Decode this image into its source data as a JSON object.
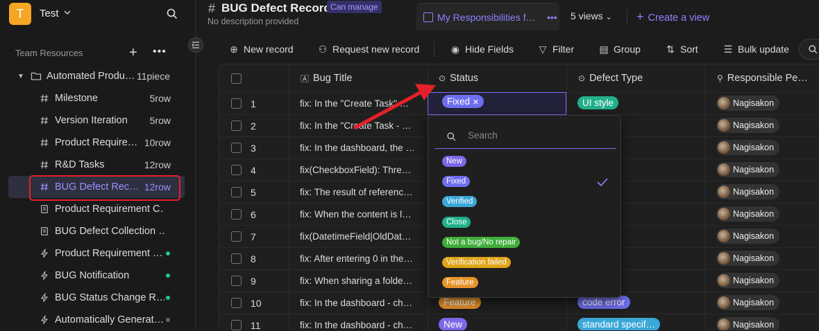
{
  "workspace": {
    "initial": "T",
    "name": "Test"
  },
  "sidebar": {
    "section_label": "Team Resources",
    "folder": {
      "label": "Automated Produ…",
      "count": "11piece"
    },
    "items": [
      {
        "label": "Milestone",
        "count": "5row",
        "icon": "hash-icon"
      },
      {
        "label": "Version Iteration",
        "count": "5row",
        "icon": "hash-icon"
      },
      {
        "label": "Product Require…",
        "count": "10row",
        "icon": "hash-icon"
      },
      {
        "label": "R&D Tasks",
        "count": "12row",
        "icon": "hash-icon"
      },
      {
        "label": "BUG Defect Rec…",
        "count": "12row",
        "icon": "hash-icon"
      },
      {
        "label": "Product Requirement C…",
        "count": "",
        "icon": "form-icon"
      },
      {
        "label": "BUG Defect Collection …",
        "count": "",
        "icon": "form-icon"
      },
      {
        "label": "Product Requirement …",
        "count": "",
        "icon": "automation-icon",
        "dot": "#22c58b"
      },
      {
        "label": "BUG Notification",
        "count": "",
        "icon": "automation-icon",
        "dot": "#22c58b"
      },
      {
        "label": "BUG Status Change R…",
        "count": "",
        "icon": "automation-icon",
        "dot": "#22c58b"
      },
      {
        "label": "Automatically Generat…",
        "count": "",
        "icon": "automation-icon",
        "dot": "#666666"
      }
    ]
  },
  "header": {
    "title": "BUG Defect Record",
    "badge": "Can manage",
    "description": "No description provided",
    "view_tab": "My Responsibilities f…",
    "views": "5 views",
    "create_view": "Create a view"
  },
  "toolbar": {
    "new_record": "New record",
    "request_new": "Request new record",
    "hide_fields": "Hide Fields",
    "filter": "Filter",
    "group": "Group",
    "sort": "Sort",
    "bulk_update": "Bulk update"
  },
  "columns": {
    "title": "Bug Title",
    "status": "Status",
    "defect_type": "Defect Type",
    "responsible": "Responsible Pe…"
  },
  "rows": [
    {
      "n": "1",
      "title": "fix: In the \"Create Task\" …",
      "status": "Fixed",
      "status_color": "#6e6ef0",
      "type": "UI style",
      "type_color": "#22b08c",
      "person": "Nagisakon"
    },
    {
      "n": "2",
      "title": "fix: In the \"Create Task - …",
      "status": "",
      "status_color": "",
      "type": "efect",
      "type_color": "#3fae3a",
      "person": "Nagisakon"
    },
    {
      "n": "3",
      "title": "fix: In the dashboard, the …",
      "status": "",
      "status_color": "",
      "type": "nce",
      "type_color": "#e8932a",
      "person": "Nagisakon"
    },
    {
      "n": "4",
      "title": "fix(CheckboxField): Thre…",
      "status": "",
      "status_color": "",
      "type": "or",
      "type_color": "#6e6ef0",
      "person": "Nagisakon"
    },
    {
      "n": "5",
      "title": "fix: The result of referenc…",
      "status": "",
      "status_color": "",
      "type": "or",
      "type_color": "#6e6ef0",
      "person": "Nagisakon"
    },
    {
      "n": "6",
      "title": "fix: When the content is l…",
      "status": "",
      "status_color": "",
      "type": "or",
      "type_color": "#6e6ef0",
      "person": "Nagisakon"
    },
    {
      "n": "7",
      "title": "fix(DatetimeField|OldDat…",
      "status": "",
      "status_color": "",
      "type": "ility",
      "type_color": "#5b7df0",
      "person": "Nagisakon"
    },
    {
      "n": "8",
      "title": "fix: After entering 0 in the…",
      "status": "",
      "status_color": "",
      "type": "or",
      "type_color": "#6e6ef0",
      "person": "Nagisakon"
    },
    {
      "n": "9",
      "title": "fix: When sharing a folde…",
      "status": "",
      "status_color": "",
      "type": "or",
      "type_color": "#6e6ef0",
      "person": "Nagisakon"
    },
    {
      "n": "10",
      "title": "fix: In the dashboard - ch…",
      "status": "Feature",
      "status_color": "#e8932a",
      "type": "code error",
      "type_color": "#6e6ef0",
      "person": "Nagisakon"
    },
    {
      "n": "11",
      "title": "fix: In the dashboard - ch…",
      "status": "New",
      "status_color": "#7a68e8",
      "type": "standard specif…",
      "type_color": "#3aa7d8",
      "person": "Nagisakon"
    }
  ],
  "dropdown": {
    "search_placeholder": "Search",
    "options": [
      {
        "label": "New",
        "color": "#7a68e8"
      },
      {
        "label": "Fixed",
        "color": "#6e6ef0",
        "checked": true
      },
      {
        "label": "Verified",
        "color": "#3aa7d8"
      },
      {
        "label": "Close",
        "color": "#22b08c"
      },
      {
        "label": "Not a bug/No repair",
        "color": "#3fae3a"
      },
      {
        "label": "Verification failed",
        "color": "#e0a418"
      },
      {
        "label": "Feature",
        "color": "#e8932a"
      }
    ]
  },
  "colors": {
    "accent": "#7b6ef6",
    "highlight_box": "#e5202a"
  }
}
